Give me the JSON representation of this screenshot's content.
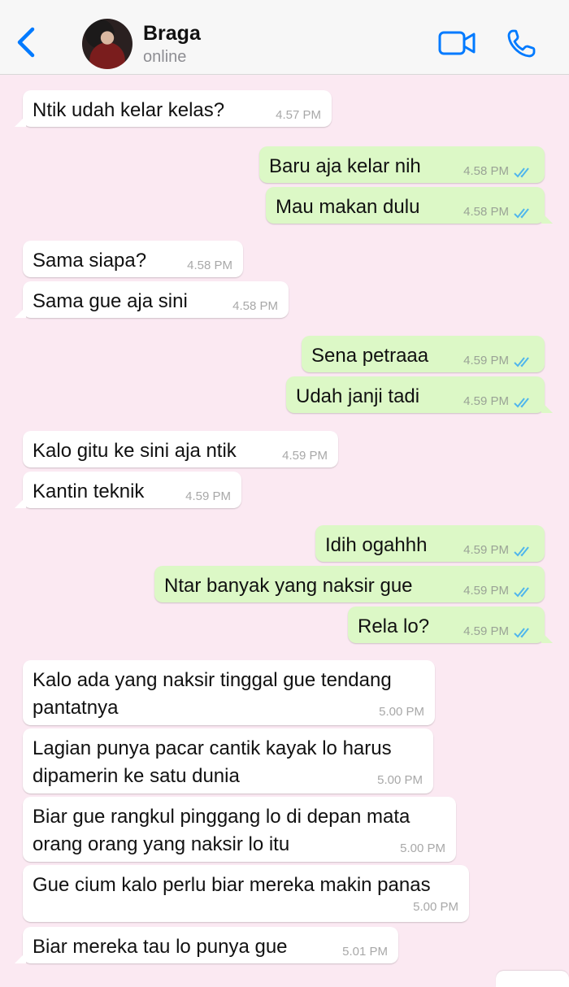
{
  "header": {
    "contact_name": "Braga",
    "status": "online",
    "accent_color": "#007aff"
  },
  "messages": [
    {
      "dir": "in",
      "text": "Ntik udah kelar kelas?",
      "time": "4.57 PM"
    },
    {
      "dir": "out",
      "text": "Baru aja kelar nih",
      "time": "4.58 PM",
      "read": true
    },
    {
      "dir": "out",
      "text": "Mau makan dulu",
      "time": "4.58 PM",
      "read": true
    },
    {
      "dir": "in",
      "text": "Sama siapa?",
      "time": "4.58 PM"
    },
    {
      "dir": "in",
      "text": "Sama gue aja sini",
      "time": "4.58 PM"
    },
    {
      "dir": "out",
      "text": "Sena petraaa",
      "time": "4.59 PM",
      "read": true
    },
    {
      "dir": "out",
      "text": "Udah janji tadi",
      "time": "4.59 PM",
      "read": true
    },
    {
      "dir": "in",
      "text": "Kalo gitu ke sini aja ntik",
      "time": "4.59 PM"
    },
    {
      "dir": "in",
      "text": "Kantin teknik",
      "time": "4.59 PM"
    },
    {
      "dir": "out",
      "text": "Idih ogahhh",
      "time": "4.59 PM",
      "read": true
    },
    {
      "dir": "out",
      "text": "Ntar banyak yang naksir gue",
      "time": "4.59 PM",
      "read": true
    },
    {
      "dir": "out",
      "text": "Rela lo?",
      "time": "4.59 PM",
      "read": true
    },
    {
      "dir": "in",
      "text": "Kalo ada yang naksir tinggal gue tendang pantatnya",
      "time": "5.00 PM"
    },
    {
      "dir": "in",
      "text": "Lagian punya pacar cantik kayak lo harus dipamerin ke satu dunia",
      "time": "5.00 PM"
    },
    {
      "dir": "in",
      "text": "Biar gue rangkul pinggang lo di depan mata orang orang yang naksir lo itu",
      "time": "5.00 PM"
    },
    {
      "dir": "in",
      "text": "Gue cium kalo perlu biar mereka makin panas",
      "time": "5.00 PM"
    },
    {
      "dir": "in",
      "text": "Biar mereka tau lo punya gue",
      "time": "5.01 PM"
    }
  ]
}
